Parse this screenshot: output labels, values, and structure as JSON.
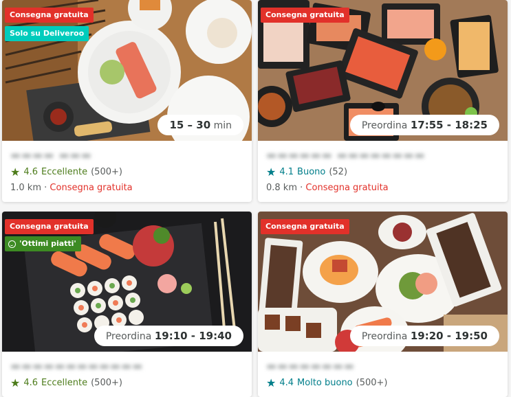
{
  "cards": [
    {
      "tags": [
        "Consegna gratuita",
        "Solo su Deliveroo"
      ],
      "time": {
        "prefix": "",
        "value": "15 – 30",
        "suffix": "min"
      },
      "name": "Ristorante",
      "rating": {
        "score": "4.6",
        "label": "Eccellente",
        "count": "(500+)",
        "color": "#4d7c1b"
      },
      "meta": {
        "distance": "1.0 km",
        "sep": "·",
        "delivery": "Consegna gratuita"
      }
    },
    {
      "tags": [
        "Consegna gratuita"
      ],
      "time": {
        "prefix": "Preordina",
        "value": "17:55 - 18:25",
        "suffix": ""
      },
      "name": "Ristorante sushi",
      "rating": {
        "score": "4.1",
        "label": "Buono",
        "count": "(52)",
        "color": "#007e8a"
      },
      "meta": {
        "distance": "0.8 km",
        "sep": "·",
        "delivery": "Consegna gratuita"
      }
    },
    {
      "tags": [
        "Consegna gratuita",
        "'Ottimi piatti'"
      ],
      "time": {
        "prefix": "Preordina",
        "value": "19:10 - 19:40",
        "suffix": ""
      },
      "name": "Sushi bar",
      "rating": {
        "score": "4.6",
        "label": "Eccellente",
        "count": "(500+)",
        "color": "#4d7c1b"
      },
      "meta": null
    },
    {
      "tags": [
        "Consegna gratuita"
      ],
      "time": {
        "prefix": "Preordina",
        "value": "19:20 - 19:50",
        "suffix": ""
      },
      "name": "Ristorante",
      "rating": {
        "score": "4.4",
        "label": "Molto buono",
        "count": "(500+)",
        "color": "#007e8a"
      },
      "meta": null
    }
  ],
  "icons": {
    "star": "star-icon",
    "smile": "smiley-icon"
  }
}
